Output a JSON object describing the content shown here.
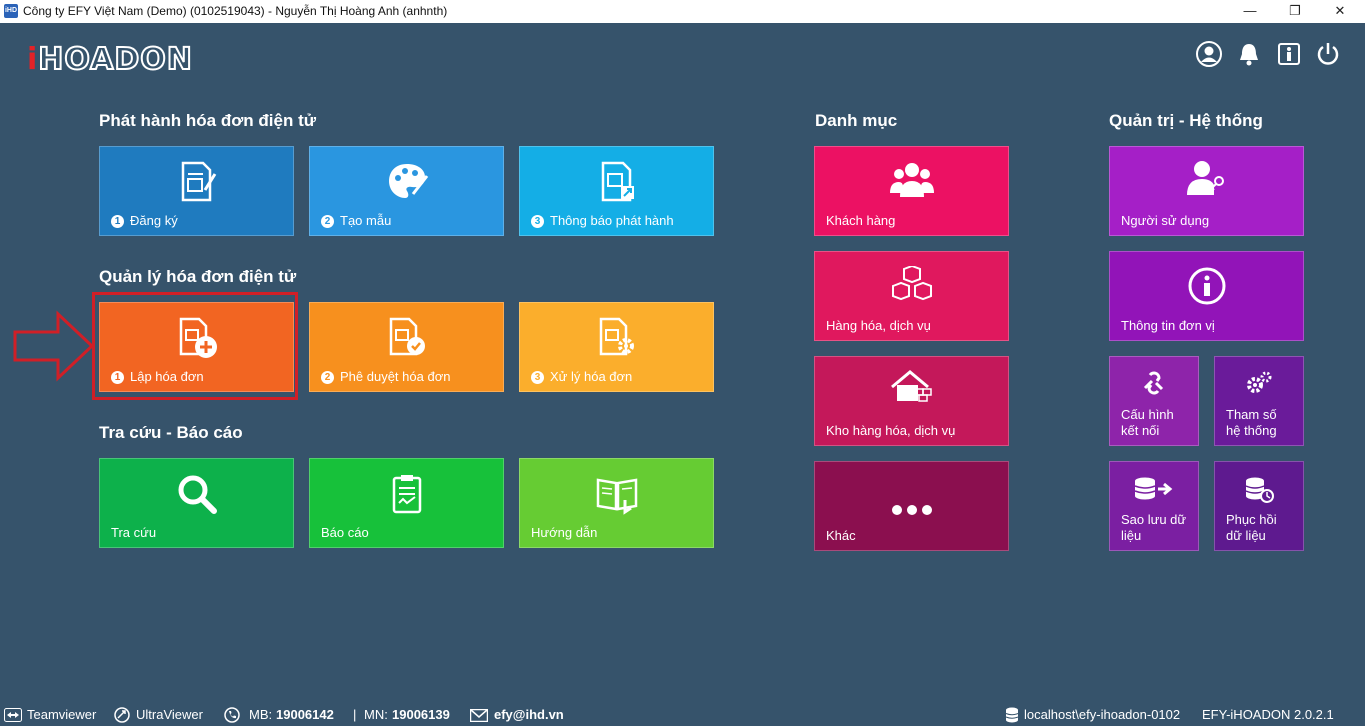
{
  "window": {
    "title": "Công ty EFY Việt Nam (Demo) (0102519043) - Nguyễn Thị Hoàng Anh (anhnth)",
    "app_icon": "iHD",
    "minimize": "—",
    "restore": "❐",
    "close": "✕"
  },
  "logo": {
    "i": "i",
    "rest": "HOADON"
  },
  "header_icons": [
    "user-icon",
    "bell-icon",
    "info-icon",
    "power-icon"
  ],
  "sections": {
    "phat_hanh": "Phát hành hóa đơn điện tử",
    "quan_ly": "Quản lý hóa đơn điện tử",
    "tra_cuu": "Tra cứu - Báo cáo",
    "danh_muc": "Danh mục",
    "quan_tri": "Quản trị - Hệ thống"
  },
  "tiles": {
    "dang_ky": {
      "num": "1",
      "label": "Đăng ký",
      "color": "#1f7bbf"
    },
    "tao_mau": {
      "num": "2",
      "label": "Tạo mẫu",
      "color": "#2a96e0"
    },
    "thong_bao": {
      "num": "3",
      "label": "Thông báo phát hành",
      "color": "#14aee6"
    },
    "lap_hoa_don": {
      "num": "1",
      "label": "Lập hóa đơn",
      "color": "#f26522"
    },
    "phe_duyet": {
      "num": "2",
      "label": "Phê duyệt hóa đơn",
      "color": "#f7901e"
    },
    "xu_ly": {
      "num": "3",
      "label": "Xử lý hóa đơn",
      "color": "#fbae2c"
    },
    "tra_cuu": {
      "label": "Tra cứu",
      "color": "#0db14b"
    },
    "bao_cao": {
      "label": "Báo cáo",
      "color": "#17c13a"
    },
    "huong_dan": {
      "label": "Hướng dẫn",
      "color": "#66cc33"
    },
    "khach_hang": {
      "label": "Khách hàng",
      "color": "#ec1163"
    },
    "hang_hoa": {
      "label": "Hàng hóa, dịch vụ",
      "color": "#e0185e"
    },
    "kho_hang_hoa": {
      "label": "Kho hàng hóa, dịch vụ",
      "color": "#c4185a"
    },
    "khac": {
      "label": "Khác",
      "color": "#8b0f4f"
    },
    "nguoi_su_dung": {
      "label": "Người sử dụng",
      "color": "#a51fc7"
    },
    "thong_tin_don_vi": {
      "label": "Thông tin đơn vị",
      "color": "#9214b8"
    },
    "cau_hinh": {
      "line1": "Cấu hình",
      "line2": "kết nối",
      "color": "#8e24aa"
    },
    "tham_so": {
      "line1": "Tham số",
      "line2": "hệ thống",
      "color": "#6a1b9a"
    },
    "sao_luu": {
      "line1": "Sao lưu dữ",
      "line2": "liệu",
      "color": "#7b1fa2"
    },
    "phuc_hoi": {
      "line1": "Phục hồi",
      "line2": "dữ liệu",
      "color": "#5e1a8f"
    }
  },
  "statusbar": {
    "teamviewer": "Teamviewer",
    "ultraviewer": "UltraViewer",
    "mb_label": "MB:",
    "mb_number": "19006142",
    "separator": "|",
    "mn_label": "MN:",
    "mn_number": "19006139",
    "email": "efy@ihd.vn",
    "db_path": "localhost\\efy-ihoadon-0102",
    "version": "EFY-iHOADON 2.0.2.1"
  }
}
